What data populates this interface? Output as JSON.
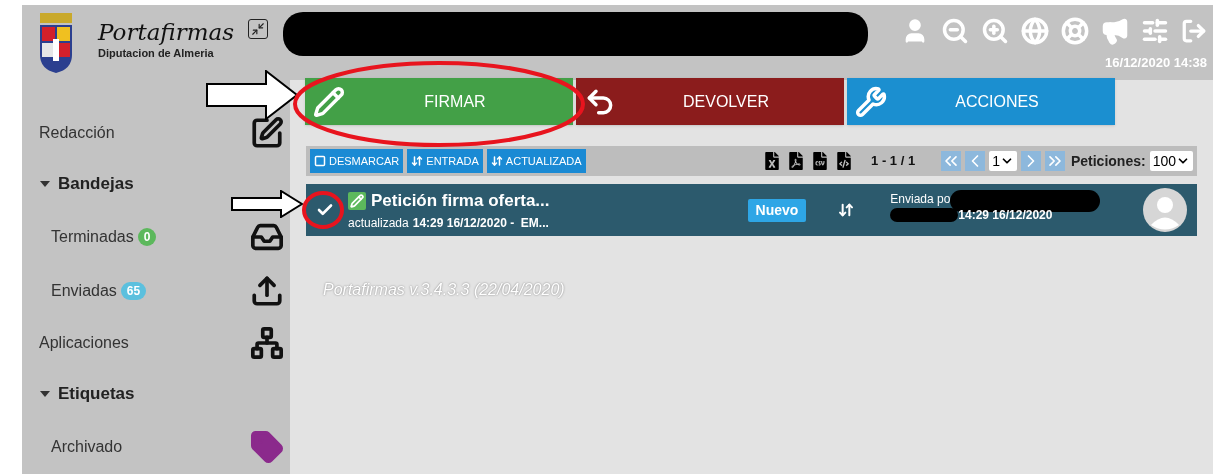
{
  "brand": {
    "title": "Portafirmas",
    "subtitle": "Diputacion de Almeria"
  },
  "header": {
    "datetime": "16/12/2020 14:38"
  },
  "sidebar": {
    "items": [
      {
        "kind": "link",
        "label": "Redacción"
      },
      {
        "kind": "section",
        "label": "Bandejas",
        "expanded": true,
        "children": [
          {
            "kind": "link",
            "label": "Terminadas",
            "badge": "0",
            "color": "#5cb85c"
          },
          {
            "kind": "link",
            "label": "Enviadas",
            "badge": "65",
            "color": "#5bc0de"
          }
        ]
      },
      {
        "kind": "link",
        "label": "Aplicaciones"
      },
      {
        "kind": "section",
        "label": "Etiquetas",
        "expanded": true,
        "children": [
          {
            "kind": "link",
            "label": "Archivado"
          }
        ]
      }
    ]
  },
  "actions": [
    {
      "label": "FIRMAR",
      "kind": "sign"
    },
    {
      "label": "DEVOLVER",
      "kind": "return"
    },
    {
      "label": "ACCIONES",
      "kind": "actions"
    }
  ],
  "toolbar": {
    "buttons": [
      {
        "label": "DESMARCAR",
        "kind": "uncheck"
      },
      {
        "label": "ENTRADA",
        "kind": "sort"
      },
      {
        "label": "ACTUALIZADA",
        "kind": "sort"
      }
    ],
    "range": "1 - 1 / 1",
    "page": "1",
    "page_size_label": "Peticiones:",
    "page_size": "100"
  },
  "requests": [
    {
      "checked": true,
      "title": "Petición firma oferta...",
      "updated_label": "actualizada",
      "updated": "14:29 16/12/2020 -  EM...",
      "status": "Nuevo",
      "sent_label": "Enviada po",
      "entry": "14:29 16/12/2020"
    }
  ],
  "footer": "Portafirmas v.3.4.3.3 (22/04/2020)"
}
